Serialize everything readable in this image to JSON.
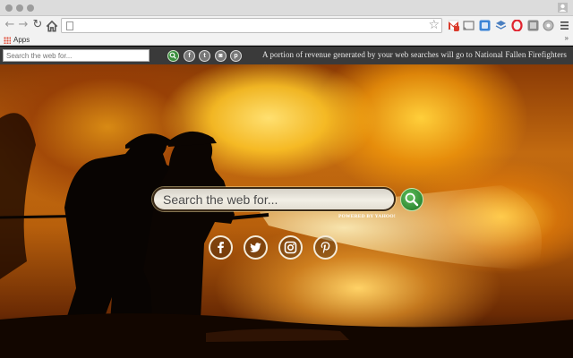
{
  "browser": {
    "url": "",
    "bookmarks_bar": {
      "apps_label": "Apps",
      "more_label": "»"
    },
    "extensions": [
      {
        "name": "gmail-icon",
        "color": "#d93a2b",
        "badge": ""
      },
      {
        "name": "cast-icon",
        "color": "#7a7a7a"
      },
      {
        "name": "extension-blue-icon",
        "color": "#3c84d6"
      },
      {
        "name": "extension-stack-icon",
        "color": "#4a7fc0"
      },
      {
        "name": "opera-icon",
        "color": "#e0242f"
      },
      {
        "name": "extension-gray-icon",
        "color": "#8a8a8a"
      },
      {
        "name": "extension-round-icon",
        "color": "#9a9a9a"
      },
      {
        "name": "extension-box-icon",
        "color": "#b0b0b0"
      }
    ]
  },
  "top_bar": {
    "search_placeholder": "Search the web for...",
    "social_icons": [
      "facebook-icon",
      "twitter-icon",
      "instagram-icon",
      "pinterest-icon"
    ],
    "notice": "A portion of revenue generated by your web searches will go to National Fallen Firefighters"
  },
  "main": {
    "search_placeholder": "Search the web for...",
    "powered_by": "POWERED BY YAHOO!",
    "social_icons": [
      "facebook-icon",
      "twitter-icon",
      "instagram-icon",
      "pinterest-icon"
    ]
  },
  "colors": {
    "go_button": "#2f8a34",
    "fire_bright": "#ffd84a",
    "fire_dark": "#8a3a05"
  }
}
